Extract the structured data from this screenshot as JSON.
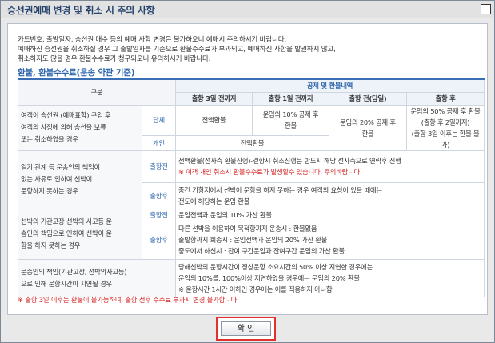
{
  "window": {
    "title": "승선권예매 변경 및 취소 시 주의 사항"
  },
  "notice": [
    "카드번호, 출발일자, 승선권 매수 등의 예매 사항 변경은 불가하오니 예매시 주의하시기 바랍니다.",
    "예매하신 승선권을 취소하실 경우 그 출발일자를 기준으로 환불수수료가 부과되고, 예매하신 사항을 발권하지 않고,",
    "취소하지도 않을 경우 환불수수료가 청구되오니 유의하시기 바랍니다."
  ],
  "section_title": "환불, 환불수수료(운송 약관 기준)",
  "table": {
    "gubun": "구분",
    "fee_group": "공제 및 환불내역",
    "columns": [
      "출항 3일 전까지",
      "출항 1일 전까지",
      "출항 전(당일)",
      "출항 후"
    ],
    "row1": {
      "head": [
        "여객이 승선권 (예매표함) 구입 후",
        "여객의 사정에 의해 승선을 보류",
        "또는 취소하였을 경우"
      ],
      "group": {
        "kind": "단체",
        "c1": "전액환불",
        "c2": [
          "운임의 10% 공제 후",
          "환불"
        ],
        "c3": [
          "운임의 20% 공제 후",
          "환불"
        ],
        "c4": [
          "운임의 50% 공제 후 환불",
          "(출항 후 2일까지)",
          "(출항 3일 이후는 환불 불가)"
        ]
      },
      "individual": {
        "kind": "개인",
        "c1": "전액환불"
      }
    },
    "row2": {
      "head": [
        "일기 관계 등 운송인의 책임이",
        "없는 사유로 인하여 선박이",
        "운항하지 못하는 경우"
      ],
      "before": {
        "kind": "출항전",
        "l1": "전액환불(선사측 환불진행)-결항시 취소진행은 반드시 해당 선사측으로 연락후 진행",
        "l2": "※ 여객 개인 취소시 환불수수료가 발생할수 있습니다. 주의바랍니다."
      },
      "after": {
        "kind": "출항후",
        "l1": "중간 기항지에서 선박이 운항을 하지 못하는 경우 여객의 요청이 있을 때에는",
        "l2": "전도에 해당하는 운임 환불"
      }
    },
    "row3": {
      "head": [
        "선박의 기관고장 선박의 사고등 운",
        "송인의 책임으로 인하여 선박이 운",
        "항을 하지 못하는 경우"
      ],
      "before": {
        "kind": "출항전",
        "l1": "운임전액과 운임의 10% 가산 환불"
      },
      "after": {
        "kind": "출항후",
        "l1": "다른 선박을 이용하여 목적항까지 운송시 : 환불없음",
        "l2": "출발항까지 회송시 : 운임전액과 운임의 20% 가산 환불",
        "l3": "중도에서 하선시 : 잔여 구간운임과 잔여구간 운임의 가산 환불"
      }
    },
    "row4": {
      "head": [
        "운송인의 책임(기관고장, 선박의사고등)",
        "으로 인해 운항시간이 지연될 경우"
      ],
      "l1": "당해선박의 운항시간이 정상운항 소요시간의 50% 이상 지연한 경우에는",
      "l2": "운임의 10%를, 100%이상 지연하였을 경우에는 운임의 20% 환불",
      "l3": "※ 운항시간 1시간 이하인 경우에는 이를 적용하지 아니함"
    }
  },
  "footnote": "※ 출항 3일 이후는 환불이 불가능하며, 출항 전후 수수료 부과시 변경 불가합니다.",
  "confirm_label": "확 인",
  "colors": {
    "accent": "#2e66ad",
    "warning": "#d42020",
    "confirm_border": "#e0312c"
  }
}
